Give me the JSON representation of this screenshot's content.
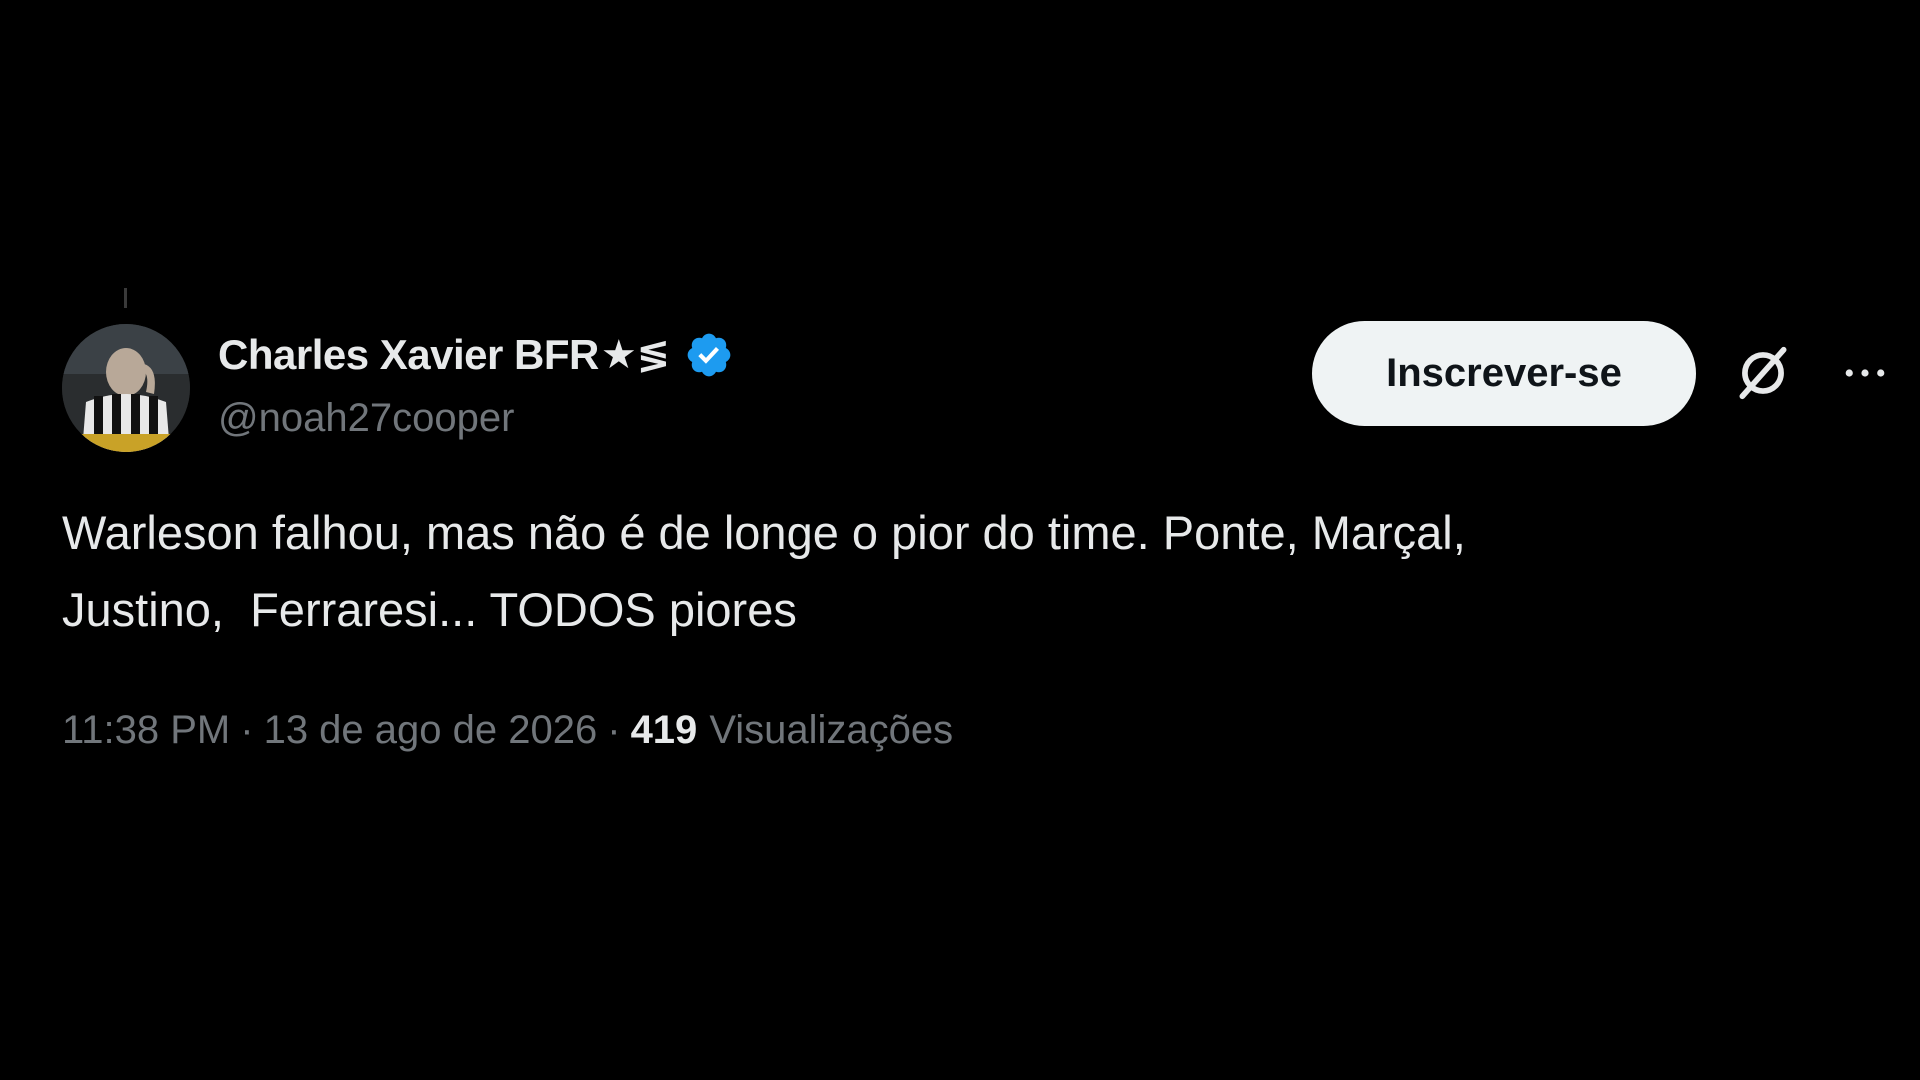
{
  "tweet": {
    "author": {
      "display_name": "Charles Xavier BFR",
      "name_emoji": "★≶",
      "handle": "@noah27cooper",
      "verified_icon": "verified-badge-icon"
    },
    "actions": {
      "subscribe_label": "Inscrever-se",
      "grok_icon": "grok-icon",
      "more_icon": "more-icon"
    },
    "text": "Warleson falhou, mas não é de longe o pior do time. Ponte, Marçal,\nJustino,  Ferraresi... TODOS piores",
    "meta": {
      "time": "11:38 PM",
      "separator": "·",
      "date": "13 de ago de 2026",
      "views_count": "419",
      "views_label": "Visualizações"
    }
  },
  "colors": {
    "background": "#000000",
    "primary_text": "#e7e9ea",
    "secondary_text": "#71767b",
    "verified": "#1d9bf0",
    "button_bg": "#eff3f4"
  }
}
